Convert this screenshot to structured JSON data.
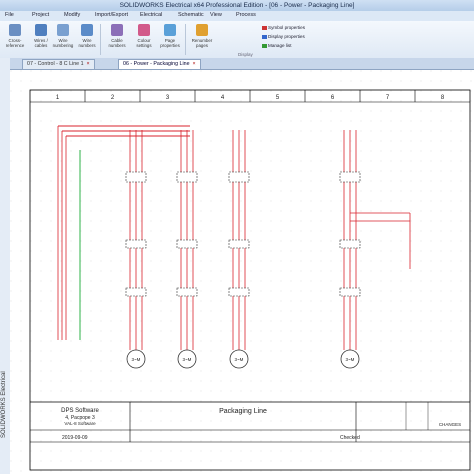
{
  "window": {
    "title": "SOLIDWORKS Electrical x64 Professional Edition - [06 - Power - Packaging Line]"
  },
  "menu": [
    "File",
    "Project",
    "Modify",
    "Import/Export",
    "Electrical",
    "Schematic",
    "View",
    "Process"
  ],
  "ribbon": {
    "buttons": [
      {
        "label": "Cross-reference",
        "icon": "cross-reference-icon",
        "color": "#6b8fc2"
      },
      {
        "label": "Wires / cables",
        "icon": "wire-style-icon",
        "color": "#4f7fbf"
      },
      {
        "label": "Wire numbering",
        "icon": "wire-numbering-icon",
        "color": "#7aa0d0"
      },
      {
        "label": "Wire numbers",
        "icon": "wire-numbers-icon",
        "color": "#5b8bc8"
      },
      {
        "label": "Cable numbers",
        "icon": "cable-numbers-icon",
        "color": "#8c6fb8"
      },
      {
        "label": "Colour settings",
        "icon": "color-settings-icon",
        "color": "#d25a8a"
      },
      {
        "label": "Page properties",
        "icon": "page-properties-icon",
        "color": "#5aa0d8"
      },
      {
        "label": "Renumber pages",
        "icon": "renumber-icon",
        "color": "#e0a030"
      }
    ],
    "smallitems": [
      "Symbol properties",
      "Display properties",
      "Manage list"
    ],
    "group_label": "Display"
  },
  "sidebar": {
    "label": "SOLIDWORKS Electrical"
  },
  "tabs": [
    {
      "label": "07 - Control - 8 C Line 1"
    },
    {
      "label": "06 - Power - Packaging Line"
    }
  ],
  "schematic": {
    "columns": [
      "1",
      "2",
      "3",
      "4",
      "5",
      "6",
      "7",
      "8"
    ],
    "motor_label": "3~M",
    "titleblock": {
      "company": "DPS Software",
      "address_1": "4, Pacpope 3",
      "address_2": "VAL-8 Software",
      "drawing_title": "Packaging Line",
      "date": "2019-09-09",
      "checked": "Checked",
      "label_changes": "CHANGES"
    }
  },
  "colors": {
    "power": "#d9232d",
    "ground": "#2fb34a",
    "wire": "#333333",
    "border": "#000000"
  }
}
